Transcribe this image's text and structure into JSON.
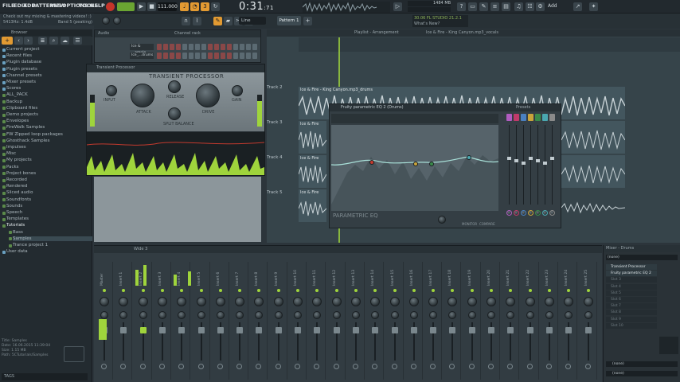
{
  "menu": {
    "items": [
      "FILE",
      "EDIT",
      "ADD",
      "PATTERNS",
      "VIEW",
      "OPTIONS",
      "TOOLS",
      "HELP"
    ]
  },
  "hint": {
    "line1": "Check out my mixing & mastering videos! :)",
    "line2": "5413Hz: 1.4dB",
    "line3": "Band 5 (peaking)"
  },
  "transport": {
    "tempo": "111.000",
    "time": "0:31",
    "time_sub": ":71",
    "pattern": "Pattern 1",
    "snap": "Line",
    "cpu": "1484 MB",
    "news_line1": "30.06  FL STUDIO 21.2.1",
    "news_line2": "What's New?",
    "add_label": "Add"
  },
  "browser": {
    "title": "Browser",
    "items": [
      {
        "label": "Current project",
        "color": "#6aa0c0"
      },
      {
        "label": "Recent files",
        "color": "#6aa0c0"
      },
      {
        "label": "Plugin database",
        "color": "#6aa0c0"
      },
      {
        "label": "Plugin presets",
        "color": "#6aa0c0"
      },
      {
        "label": "Channel presets",
        "color": "#6aa0c0"
      },
      {
        "label": "Mixer presets",
        "color": "#6aa0c0"
      },
      {
        "label": "Scores",
        "color": "#6aa0c0"
      },
      {
        "label": "ALL_PACK",
        "color": "#5b8a4a"
      },
      {
        "label": "Backup",
        "color": "#5b8a4a"
      },
      {
        "label": "Clipboard files",
        "color": "#5b8a4a"
      },
      {
        "label": "Demo projects",
        "color": "#5b8a4a"
      },
      {
        "label": "Envelopes",
        "color": "#5b8a4a"
      },
      {
        "label": "FireWalk Samples",
        "color": "#5b8a4a"
      },
      {
        "label": "FW Zipped loop packages",
        "color": "#5b8a4a"
      },
      {
        "label": "Ghosthack Samples",
        "color": "#5b8a4a"
      },
      {
        "label": "Impulses",
        "color": "#5b8a4a"
      },
      {
        "label": "Misc",
        "color": "#5b8a4a"
      },
      {
        "label": "My projects",
        "color": "#5b8a4a"
      },
      {
        "label": "Packs",
        "color": "#5b8a4a"
      },
      {
        "label": "Project bones",
        "color": "#5b8a4a"
      },
      {
        "label": "Recorded",
        "color": "#5b8a4a"
      },
      {
        "label": "Rendered",
        "color": "#5b8a4a"
      },
      {
        "label": "Sliced audio",
        "color": "#5b8a4a"
      },
      {
        "label": "Soundfonts",
        "color": "#5b8a4a"
      },
      {
        "label": "Sounds",
        "color": "#5b8a4a"
      },
      {
        "label": "Speech",
        "color": "#5b8a4a"
      },
      {
        "label": "Templates",
        "color": "#5b8a4a"
      },
      {
        "label": "Tutorials",
        "color": "#5b8a4a"
      },
      {
        "label": "Bass",
        "color": "#5b8a4a"
      },
      {
        "label": "Samples",
        "color": "#5b8a4a"
      },
      {
        "label": "Trance project 1",
        "color": "#5b8a4a"
      },
      {
        "label": "User data",
        "color": "#6aa0c0"
      }
    ],
    "info": {
      "title": "Title: Samples",
      "date": "Date: 16.06.2015 11:39:04",
      "size": "Size: 1.15 MB",
      "path": "Path: 5CTutorials/Samples"
    },
    "search_value": "TAGS"
  },
  "channel_rack": {
    "title": "Channel rack",
    "filter": "Audio",
    "channels": [
      "Ice & ...ample",
      "Ice_...drums"
    ]
  },
  "playlist": {
    "title": "Playlist - Arrangement",
    "breadcrumb": "Ice & Fire - King Canyon.mp3_vocals",
    "tracks": [
      "Track 2",
      "Track 3",
      "Track 4",
      "Track 5"
    ],
    "clip_titles": [
      "Ice & Fire - King Canyon.mp3_drums",
      "Ice & Fire",
      "Ice & Fire",
      "Ice & Fire"
    ]
  },
  "transient": {
    "window_title": "Transient Processor",
    "header": "TRANSIENT PROCESSOR",
    "knobs": [
      "INPUT",
      "ATTACK",
      "RELEASE",
      "DRIVE",
      "SPLIT BALANCE",
      "GAIN"
    ]
  },
  "eq": {
    "window_title": "Fruity parametric EQ 2 (Drums)",
    "logo": "PARAMETRIC EQ",
    "presets": "Presets",
    "bottom_labels": [
      "MONITOR",
      "COMPARE"
    ]
  },
  "mixer": {
    "title": "Wide 3",
    "strip_labels": [
      "Master",
      "Insert 1",
      "Insert 2",
      "Insert 3",
      "Insert 4",
      "Insert 5",
      "Insert 6",
      "Insert 7",
      "Insert 8",
      "Insert 9",
      "Insert 10",
      "Insert 11",
      "Insert 12",
      "Insert 13",
      "Insert 14",
      "Insert 15",
      "Insert 16",
      "Insert 17",
      "Insert 18",
      "Insert 19",
      "Insert 20",
      "Insert 21",
      "Insert 22",
      "Insert 23",
      "Insert 24",
      "Insert 25"
    ]
  },
  "mixer_right": {
    "title": "Mixer - Drums",
    "input": "(none)",
    "slots": [
      "Transient Processor",
      "Fruity parametric EQ 2",
      "Slot 3",
      "Slot 4",
      "Slot 5",
      "Slot 6",
      "Slot 7",
      "Slot 8",
      "Slot 9",
      "Slot 10"
    ],
    "out1": "(none)",
    "out2": "(none)"
  },
  "colors": {
    "accent": "#9fd43c",
    "orange": "#e29a32"
  }
}
